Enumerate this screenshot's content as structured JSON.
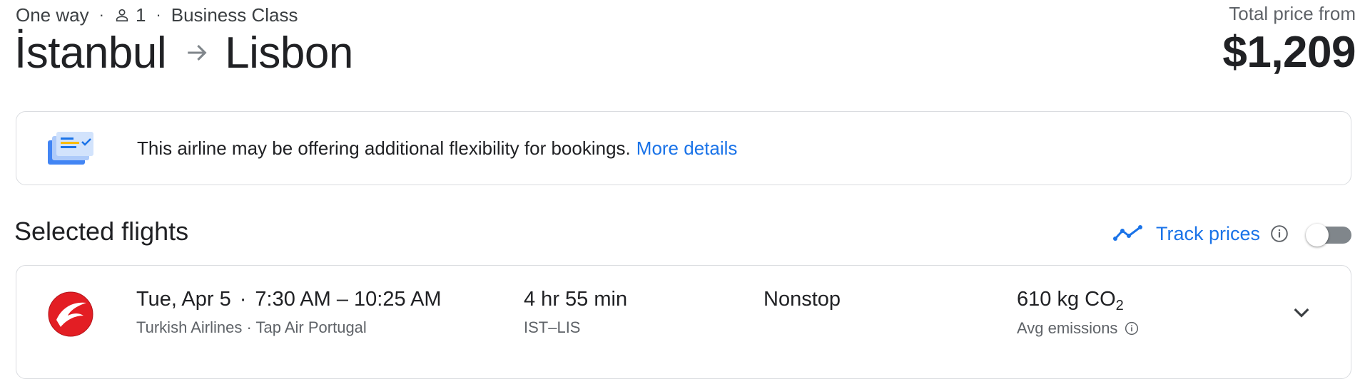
{
  "header": {
    "trip_type": "One way",
    "passengers": "1",
    "cabin_class": "Business Class",
    "origin": "İstanbul",
    "destination": "Lisbon",
    "total_label": "Total price from",
    "total_price": "$1,209"
  },
  "banner": {
    "text": "This airline may be offering additional flexibility for bookings.",
    "link": "More details",
    "icon": "flexibility-document-icon"
  },
  "selected_flights": {
    "title": "Selected flights",
    "track_prices_label": "Track prices",
    "track_prices_enabled": false
  },
  "flight": {
    "date": "Tue, Apr 5",
    "times": "7:30 AM – 10:25 AM",
    "airlines": "Turkish Airlines · Tap Air Portugal",
    "duration": "4 hr 55 min",
    "airports": "IST–LIS",
    "stops": "Nonstop",
    "emissions_value": "610 kg CO",
    "emissions_sub": "2",
    "emissions_label": "Avg emissions",
    "airline_logo": "turkish-airlines-logo"
  },
  "colors": {
    "accent": "#1a73e8",
    "text": "#202124",
    "secondary_text": "#5f6368",
    "border": "#dadce0",
    "logo_red": "#e31e24"
  }
}
